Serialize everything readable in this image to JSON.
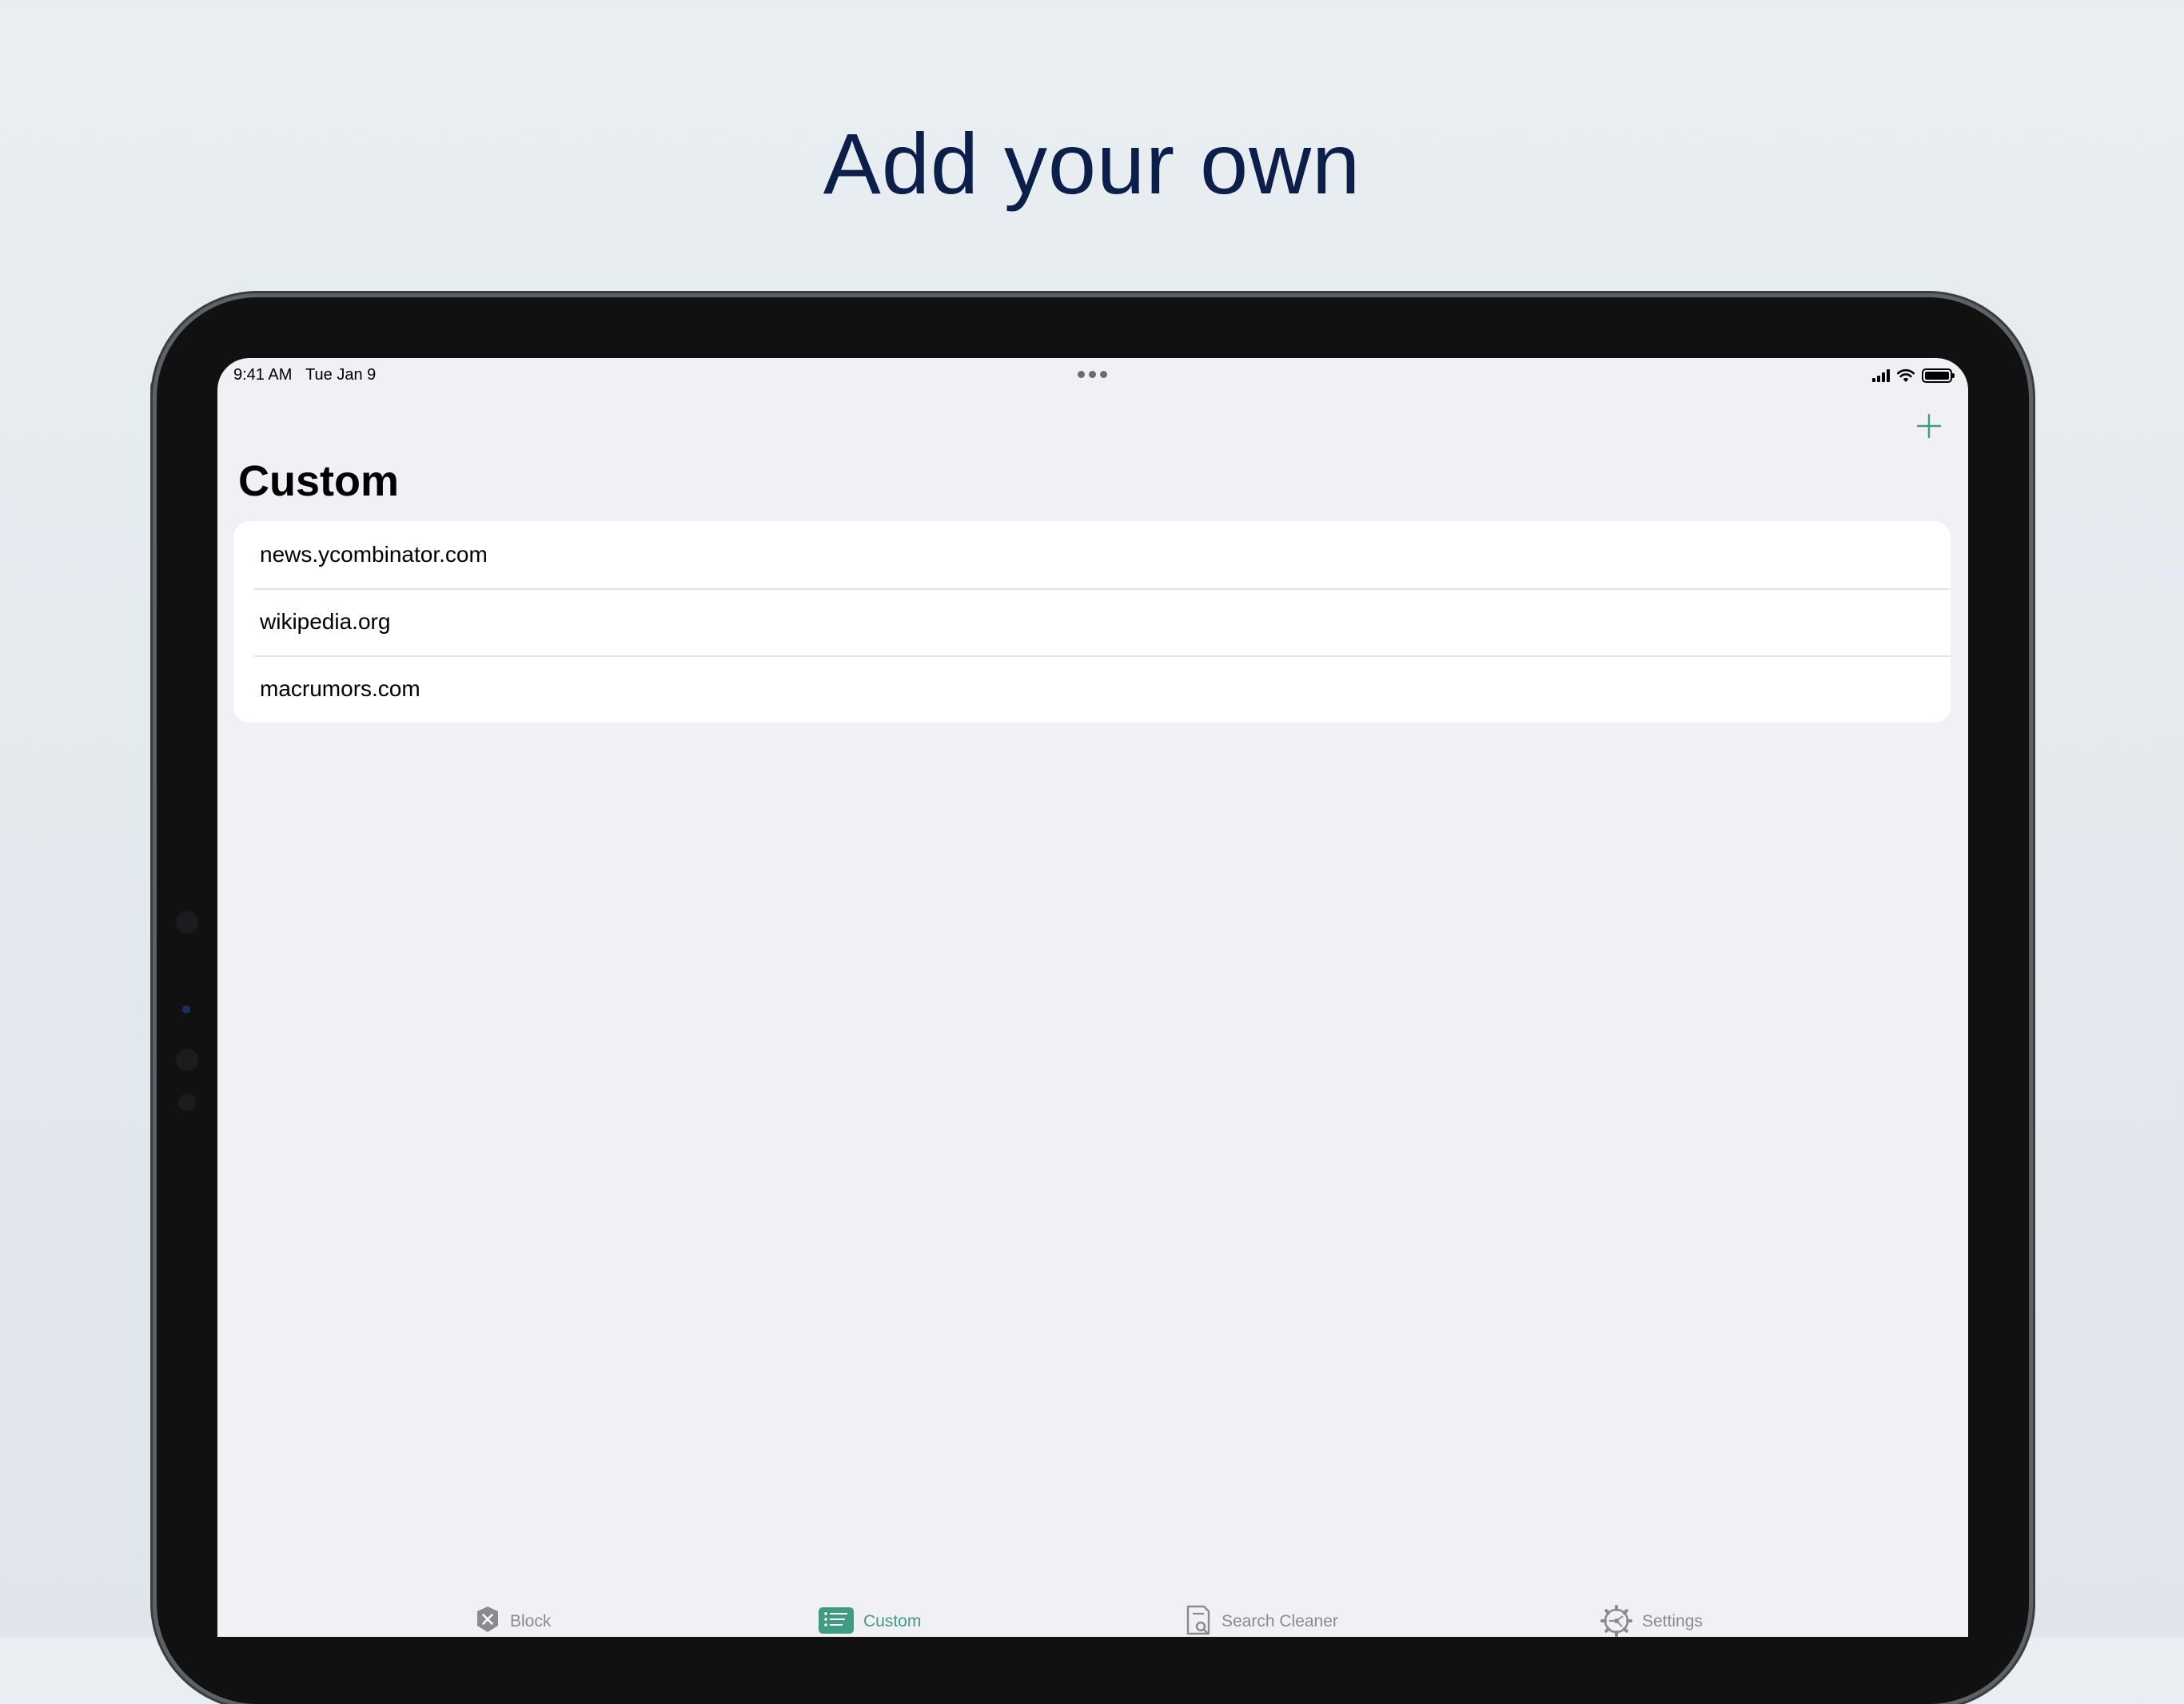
{
  "headline": "Add your own",
  "colors": {
    "accent": "#3f9c82",
    "headline": "#0c1f4a",
    "inactive_tab": "#8a8a8f",
    "screen_background": "#f0f0f5"
  },
  "status_bar": {
    "time": "9:41 AM",
    "date": "Tue Jan 9",
    "icons": [
      "cellular-signal-icon",
      "wifi-icon",
      "battery-icon"
    ]
  },
  "nav": {
    "title": "Custom",
    "add_icon": "plus-icon"
  },
  "custom_list": {
    "items": [
      "news.ycombinator.com",
      "wikipedia.org",
      "macrumors.com"
    ]
  },
  "tab_bar": {
    "active": "Custom",
    "items": [
      {
        "label": "Block",
        "icon": "shield-x-icon"
      },
      {
        "label": "Custom",
        "icon": "list-icon"
      },
      {
        "label": "Search Cleaner",
        "icon": "document-search-icon"
      },
      {
        "label": "Settings",
        "icon": "gear-icon"
      }
    ]
  }
}
